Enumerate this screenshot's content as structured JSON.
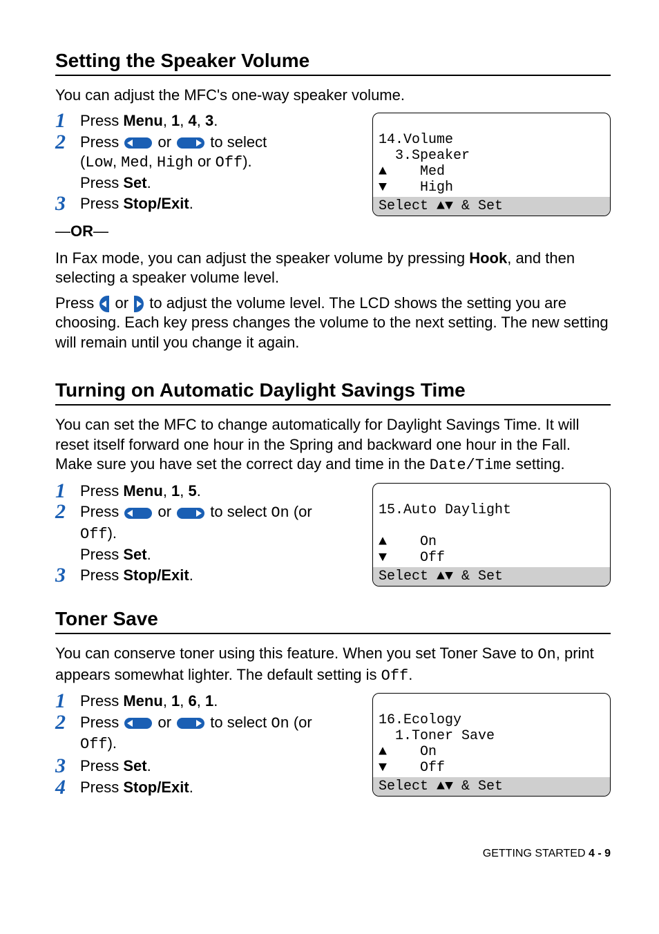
{
  "section1": {
    "heading": "Setting the Speaker Volume",
    "intro": "You can adjust the MFC's one-way speaker volume.",
    "steps": {
      "s1a": "Press ",
      "s1b": "Menu",
      "s1c": ", ",
      "s1d": "1",
      "s1e": ", ",
      "s1f": "4",
      "s1g": ", ",
      "s1h": "3",
      "s1i": ".",
      "s2a": "Press ",
      "s2b": " or ",
      "s2c": " to select",
      "s2d_open": "(",
      "s2e": "Low",
      "s2f": ", ",
      "s2g": "Med",
      "s2h": ", ",
      "s2i": "High",
      "s2j": " or ",
      "s2k": "Off",
      "s2l": ").",
      "s2m": "Press ",
      "s2n": "Set",
      "s2o": ".",
      "s3a": "Press ",
      "s3b": "Stop/Exit",
      "s3c": "."
    },
    "lcd": {
      "l1": "14.Volume",
      "l2": "  3.Speaker",
      "l3": "▲    Med",
      "l4": "▼    High",
      "bar": "Select ▲▼ & Set"
    },
    "or": "—OR—",
    "or_bold": "OR",
    "or_pre": "—",
    "or_post": "—",
    "p1a": "In Fax mode, you can adjust the speaker volume by pressing ",
    "p1b": "Hook",
    "p1c": ", and then selecting a speaker volume level.",
    "p2a": "Press ",
    "p2b": " or ",
    "p2c": " to adjust the volume level. The LCD shows the setting you are choosing. Each key press changes the volume to the next setting. The new setting will remain until you change it again."
  },
  "section2": {
    "heading": "Turning on Automatic Daylight Savings Time",
    "intro_a": "You can set the MFC to change automatically for Daylight Savings Time. It will reset itself forward one hour in the Spring and backward one hour in the Fall. Make sure you have set the correct day and time in the ",
    "intro_b": "Date/Time",
    "intro_c": " setting.",
    "steps": {
      "s1a": "Press ",
      "s1b": "Menu",
      "s1c": ", ",
      "s1d": "1",
      "s1e": ", ",
      "s1f": "5",
      "s1g": ".",
      "s2a": "Press ",
      "s2b": " or ",
      "s2c": " to select ",
      "s2d": "On",
      "s2e": " (or ",
      "s2f": "Off",
      "s2g": ").",
      "s2h": "Press ",
      "s2i": "Set",
      "s2j": ".",
      "s3a": "Press ",
      "s3b": "Stop/Exit",
      "s3c": "."
    },
    "lcd": {
      "l1": "15.Auto Daylight",
      "l2": " ",
      "l3": "▲    On",
      "l4": "▼    Off",
      "bar": "Select ▲▼ & Set"
    }
  },
  "section3": {
    "heading": "Toner Save",
    "intro_a": "You can conserve toner using this feature. When you set Toner Save to ",
    "intro_b": "On",
    "intro_c": ", print appears somewhat lighter. The default setting is ",
    "intro_d": "Off",
    "intro_e": ".",
    "steps": {
      "s1a": "Press ",
      "s1b": "Menu",
      "s1c": ", ",
      "s1d": "1",
      "s1e": ", ",
      "s1f": "6",
      "s1g": ", ",
      "s1h": "1",
      "s1i": ".",
      "s2a": "Press ",
      "s2b": " or ",
      "s2c": " to select ",
      "s2d": "On",
      "s2e": " (or ",
      "s2f": "Off",
      "s2g": ").",
      "s3a": "Press ",
      "s3b": "Set",
      "s3c": ".",
      "s4a": "Press ",
      "s4b": "Stop/Exit",
      "s4c": "."
    },
    "lcd": {
      "l1": "16.Ecology",
      "l2": "  1.Toner Save",
      "l3": "▲    On",
      "l4": "▼    Off",
      "bar": "Select ▲▼ & Set"
    }
  },
  "footer": {
    "label": "GETTING STARTED   ",
    "page": "4 - 9"
  }
}
